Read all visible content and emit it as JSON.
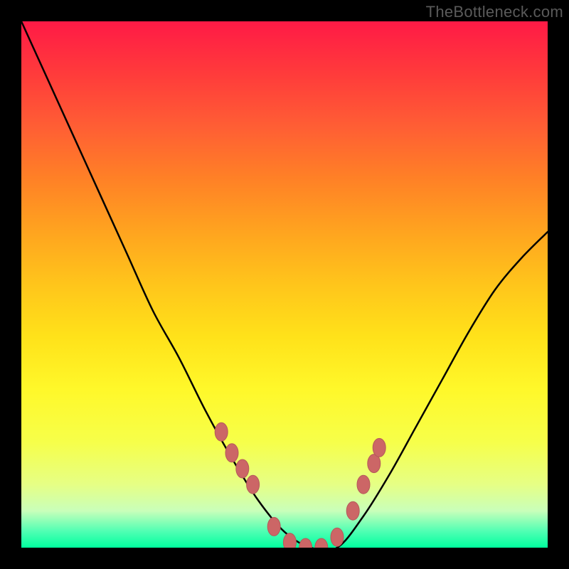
{
  "watermark": "TheBottleneck.com",
  "colors": {
    "curve": "#000000",
    "marker": "#cc6666",
    "marker_stroke": "#b45a5a"
  },
  "chart_data": {
    "type": "line",
    "title": "",
    "xlabel": "",
    "ylabel": "",
    "xlim": [
      0,
      1
    ],
    "ylim": [
      0,
      1
    ],
    "x": [
      0.0,
      0.05,
      0.1,
      0.15,
      0.2,
      0.25,
      0.3,
      0.35,
      0.4,
      0.45,
      0.5,
      0.55,
      0.6,
      0.65,
      0.7,
      0.75,
      0.8,
      0.85,
      0.9,
      0.95,
      1.0
    ],
    "values": [
      1.0,
      0.89,
      0.78,
      0.67,
      0.56,
      0.45,
      0.36,
      0.26,
      0.17,
      0.09,
      0.03,
      0.0,
      0.0,
      0.06,
      0.14,
      0.23,
      0.32,
      0.41,
      0.49,
      0.55,
      0.6
    ],
    "markers_x": [
      0.38,
      0.4,
      0.42,
      0.44,
      0.48,
      0.51,
      0.54,
      0.57,
      0.6,
      0.63,
      0.65,
      0.67,
      0.68
    ],
    "markers_y": [
      0.22,
      0.18,
      0.15,
      0.12,
      0.04,
      0.01,
      0.0,
      0.0,
      0.02,
      0.07,
      0.12,
      0.16,
      0.19
    ]
  }
}
